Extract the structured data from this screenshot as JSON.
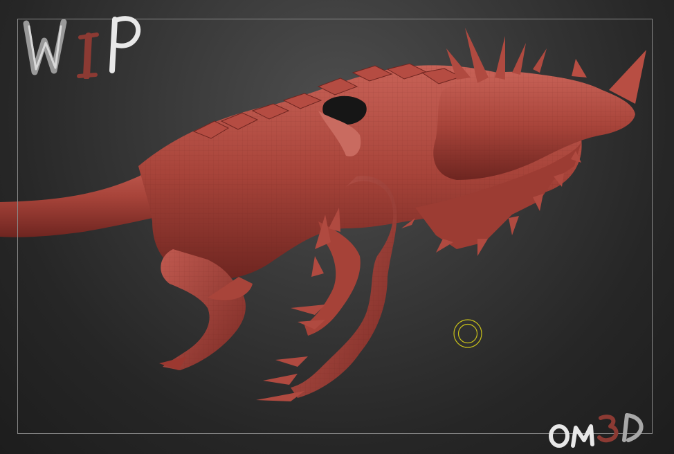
{
  "watermarks": {
    "top_left": "WIP",
    "bottom_right": "OM3D"
  },
  "colors": {
    "clay": "#a8443a",
    "clay_dark": "#6e2520",
    "clay_light": "#c9675c",
    "frame": "#8a8a8a",
    "brush_cursor": "#c9c21a",
    "logo_white": "#e8e8e8",
    "logo_red": "#8c3a33"
  },
  "icons": {
    "cursor": "brush-cursor-icon"
  }
}
